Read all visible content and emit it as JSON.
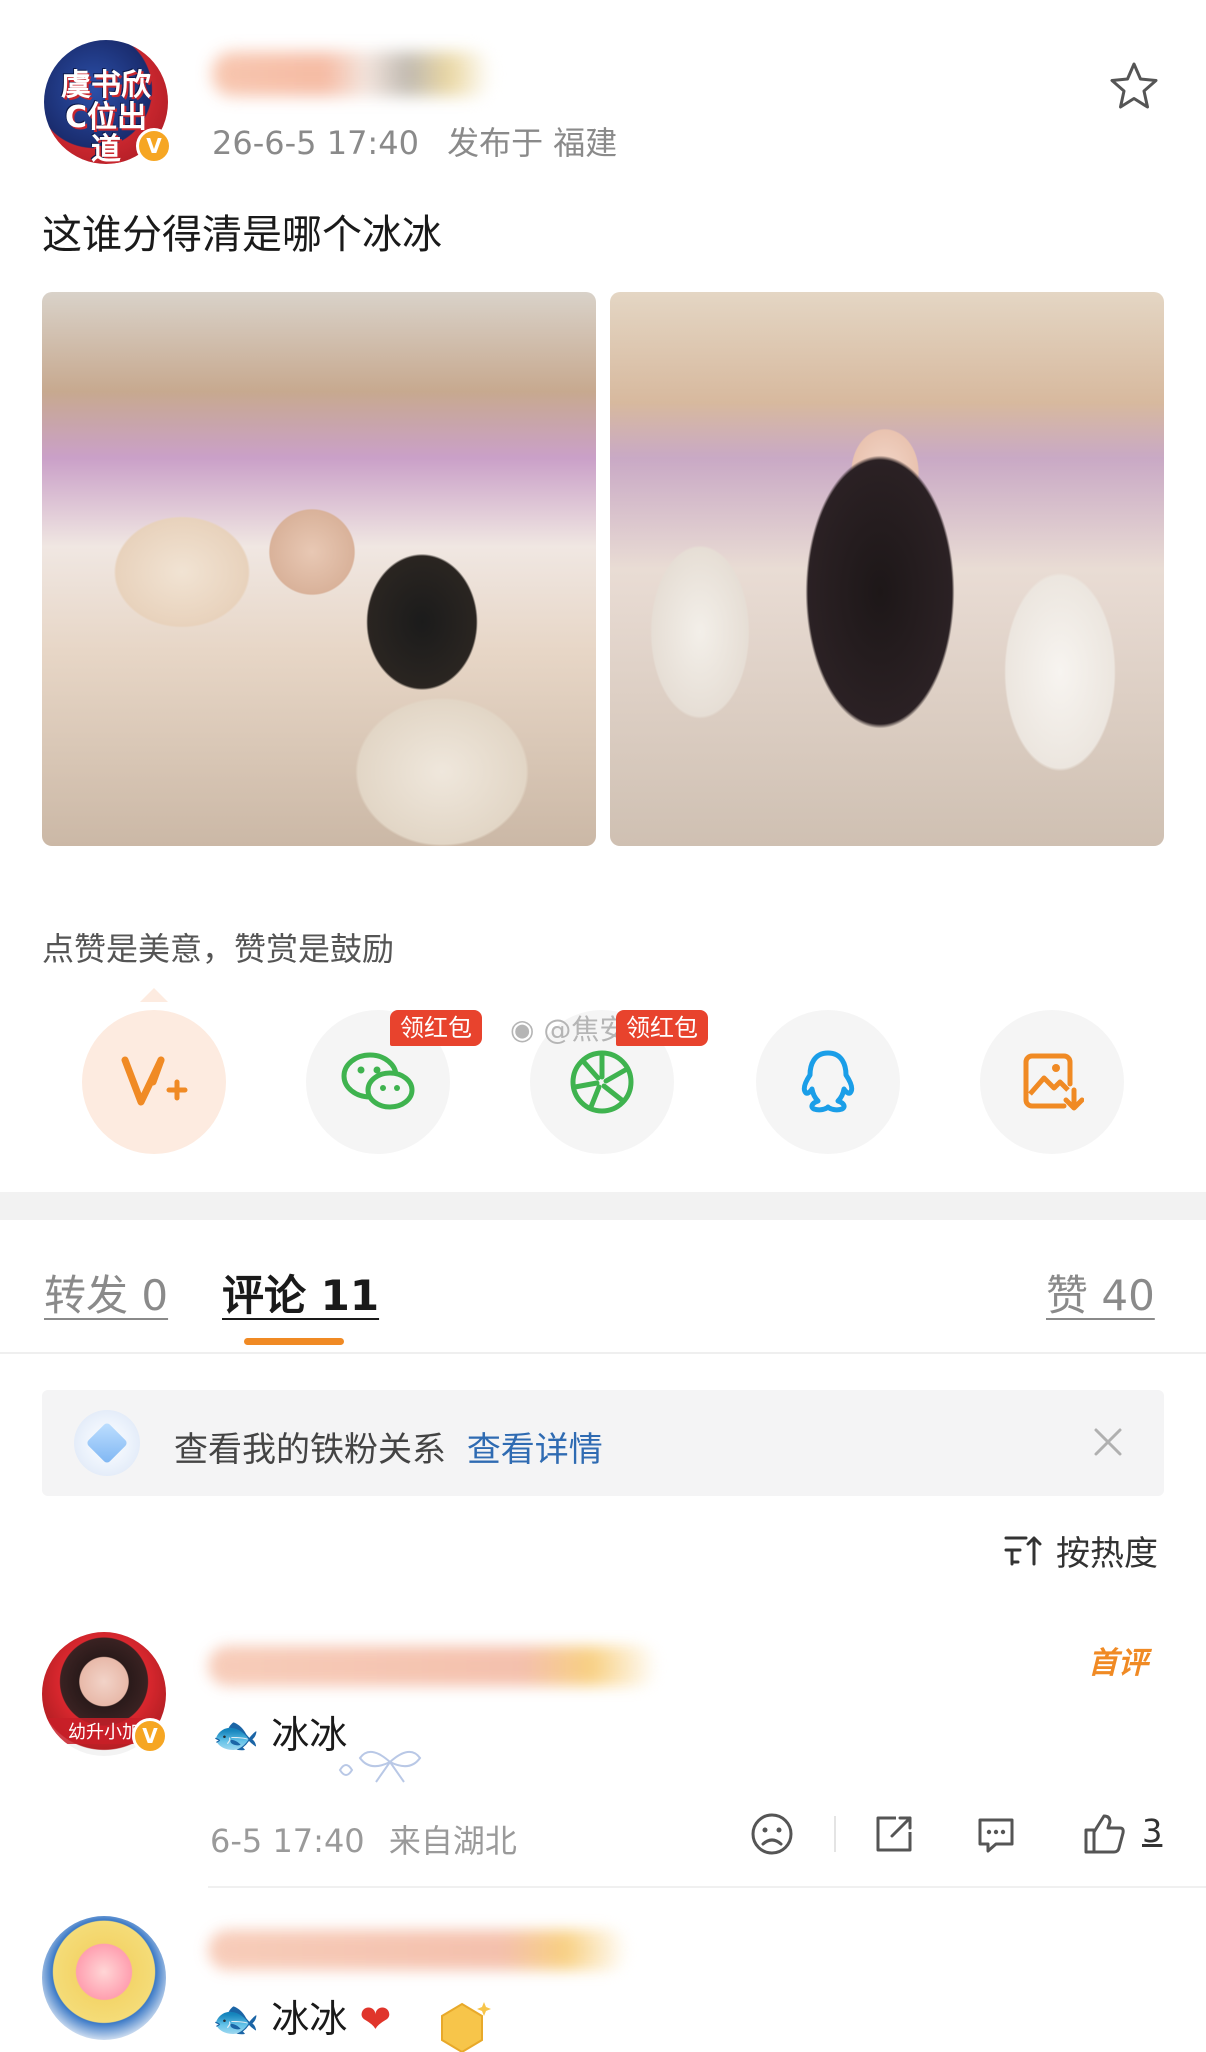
{
  "post": {
    "time": "26-6-5 17:40",
    "published_from_label": "发布于",
    "location": "福建",
    "text": "这谁分得清是哪个冰冰",
    "avatar_logo": "虞书欣C位出道"
  },
  "reward": {
    "prompt": "点赞是美意，赞赏是鼓励",
    "wechat_badge": "领红包",
    "moments_badge": "领红包",
    "watermark": "@焦安然"
  },
  "share_icons": [
    "v-plus-icon",
    "wechat-icon",
    "moments-icon",
    "qq-icon",
    "save-image-icon"
  ],
  "tabs": {
    "repost": "转发 0",
    "comments": "评论 11",
    "likes": "赞 40"
  },
  "fan_bar": {
    "text": "查看我的铁粉关系",
    "link": "查看详情"
  },
  "sort": {
    "label": "按热度"
  },
  "comments": [
    {
      "avatar_caption": "幼升小加",
      "badge": "首评",
      "text": "冰冰",
      "time": "6-5 17:40",
      "from": "来自湖北",
      "likes": "3"
    },
    {
      "text": "冰冰"
    }
  ],
  "colors": {
    "accent_orange": "#f08a24",
    "link_blue": "#2f6bb2",
    "red_badge": "#e8432d",
    "wechat_green": "#3fb34f",
    "qq_blue": "#1a9ee8"
  }
}
